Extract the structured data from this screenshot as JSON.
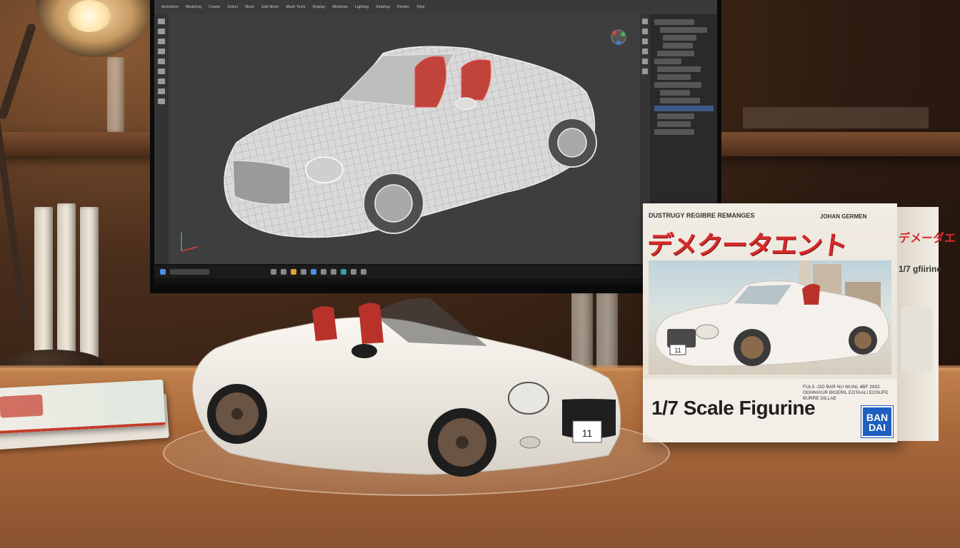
{
  "monitor": {
    "menu_items": [
      "Animation",
      "Modeling",
      "Create",
      "Select",
      "Mesh",
      "Edit Mesh",
      "Mesh Tools",
      "Display",
      "Windows",
      "Lighting",
      "Shading",
      "Render",
      "Help"
    ]
  },
  "box": {
    "top_left_text": "DUSTRUGY REGIBRE REMANGES",
    "top_right_text": "JOHAN GERMEN",
    "japanese_title": "デメクータエント",
    "side_japanese": "デメーダエ",
    "side_scale": "1/7 gfiirine",
    "plate": "11",
    "small_print": "FULS -OO BAR NU WUNL 4BF 2932 OGHNIXUR BIGERIL EOTAALI EOSUFE BURRE DILLAE",
    "title": "1/7 Scale Figurine",
    "brand_line1": "BAN",
    "brand_line2": "DAI"
  },
  "model": {
    "plate": "11"
  },
  "colors": {
    "box_red": "#d62a2a",
    "brand_blue": "#1e5fbf",
    "car_white": "#eeeae4",
    "seat_red": "#b8322a"
  }
}
